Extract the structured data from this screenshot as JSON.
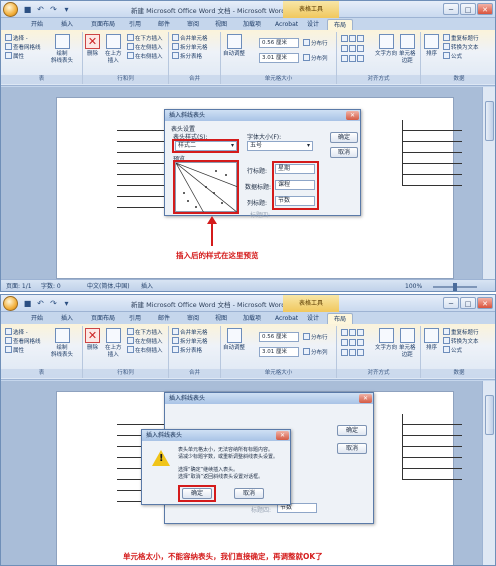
{
  "window": {
    "title": "新建 Microsoft Office Word 文档 - Microsoft Word",
    "tools_label": "表格工具",
    "controls": [
      "─",
      "□",
      "✕"
    ]
  },
  "qat_icons": [
    "save-icon",
    "undo-icon",
    "redo-icon",
    "customize-icon"
  ],
  "tabs": [
    "开始",
    "插入",
    "页面布局",
    "引用",
    "邮件",
    "审阅",
    "视图",
    "加载项",
    "Acrobat",
    "设计",
    "布局"
  ],
  "ribbon": {
    "table_group": {
      "label": "表",
      "items": [
        "选择 -",
        "查看网格线",
        "属性"
      ],
      "draw_diag": "绘制\n斜线表头"
    },
    "rowcol_group": {
      "label": "行和列",
      "delete": "删除",
      "insert_above": "在上方\n插入",
      "items": [
        "在下方插入",
        "在左侧插入",
        "在右侧插入"
      ]
    },
    "merge_group": {
      "label": "合并",
      "items": [
        "合并单元格",
        "拆分单元格",
        "拆分表格"
      ]
    },
    "cellsize_group": {
      "label": "单元格大小",
      "autofit": "自动调整",
      "height": "0.56 厘米",
      "width": "3.01 厘米",
      "dist_rows": "分布行",
      "dist_cols": "分布列"
    },
    "align_group": {
      "label": "对齐方式",
      "text_dir": "文字方向",
      "margins": "单元格\n边距"
    },
    "data_group": {
      "label": "数据",
      "sort": "排序",
      "items": [
        "重复标题行",
        "转换为文本",
        "公式"
      ]
    }
  },
  "status": {
    "page": "页面: 1/1",
    "words": "字数: 0",
    "lang": "中文(简体,中国)",
    "mode": "插入",
    "zoom": "100%"
  },
  "dialog1": {
    "title": "插入斜线表头",
    "section": "表头设置",
    "style_label": "表头样式(S):",
    "style_value": "样式二",
    "font_label": "字体大小(F):",
    "font_value": "五号",
    "preview_label": "预览",
    "row_label": "行标题:",
    "row_value": "星期",
    "data_label": "数据标题:",
    "data_value": "课程",
    "col_label": "列标题:",
    "col_value": "节数",
    "extra_label": "标题四:",
    "ok": "确定",
    "cancel": "取消"
  },
  "annotation1": "插入后的样式在这里预览",
  "dialog2": {
    "title": "插入斜线表头",
    "message": [
      "表头单元格太小，无法容纳所有标题内容。",
      "请减少标题字数，或重新调整斜线表头设置。",
      "",
      "选择“确定”继续插入表头。",
      "选择“取消”返回斜线表头设置对话框。"
    ],
    "ok": "确定",
    "cancel": "取消",
    "underlying_ok": "确定",
    "underlying_cancel": "取消",
    "underlying_field": "节数",
    "underlying_label": "标题四:"
  },
  "annotation2": "单元格太小，不能容纳表头，我们直接确定，再调整就OK了",
  "colors": {
    "annotation_red": "#d41b1b",
    "ribbon_blue": "#c5d6ec",
    "tools_tab": "#f0c75e"
  }
}
